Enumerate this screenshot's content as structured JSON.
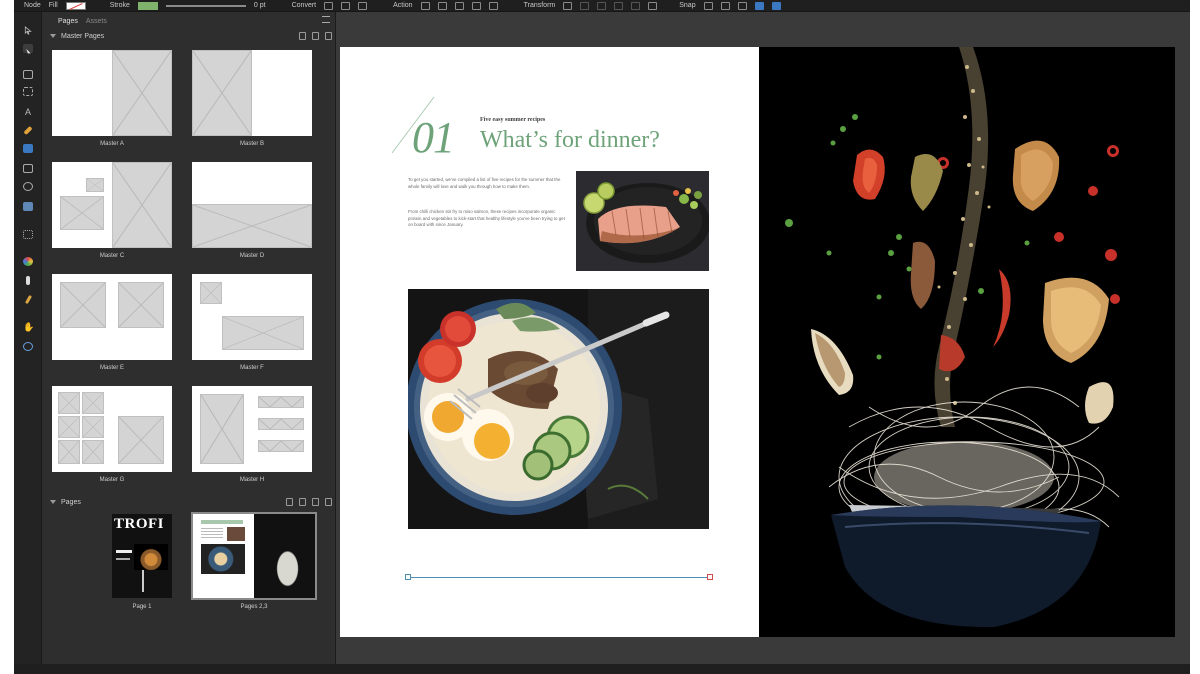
{
  "toolbar": {
    "mode_label": "Node",
    "fill_label": "Fill",
    "stroke_label": "Stroke",
    "width_value": "0 pt",
    "convert_label": "Convert",
    "action_label": "Action",
    "transform_label": "Transform",
    "snap_label": "Snap"
  },
  "panel": {
    "tabs": [
      {
        "label": "Pages",
        "active": true
      },
      {
        "label": "Assets",
        "active": false
      }
    ],
    "master_section_title": "Master Pages",
    "masters": [
      {
        "label": "Master A"
      },
      {
        "label": "Master B"
      },
      {
        "label": "Master C"
      },
      {
        "label": "Master D"
      },
      {
        "label": "Master E"
      },
      {
        "label": "Master F"
      },
      {
        "label": "Master G"
      },
      {
        "label": "Master H"
      }
    ],
    "pages_section_title": "Pages",
    "pages": [
      {
        "label": "Page 1",
        "cover_title": "TROFI"
      },
      {
        "label": "Pages 2,3"
      }
    ]
  },
  "spread": {
    "big_number": "01",
    "kicker": "Five easy summer recipes",
    "headline": "What’s for dinner?",
    "body_paragraphs": [
      "To get you started, we've compiled a list of five recipes for the summer that the whole family will love and walk you through how to make them.",
      "From chilli chicken stir fry to miso salmon, these recipes incorporate organic protein and vegetables to kick-start that healthy lifestyle you've been trying to get on board with since January."
    ]
  },
  "colors": {
    "accent_green": "#6ea37a",
    "selection_blue": "#4d8fb0",
    "ui_dark": "#2b2b2b"
  }
}
